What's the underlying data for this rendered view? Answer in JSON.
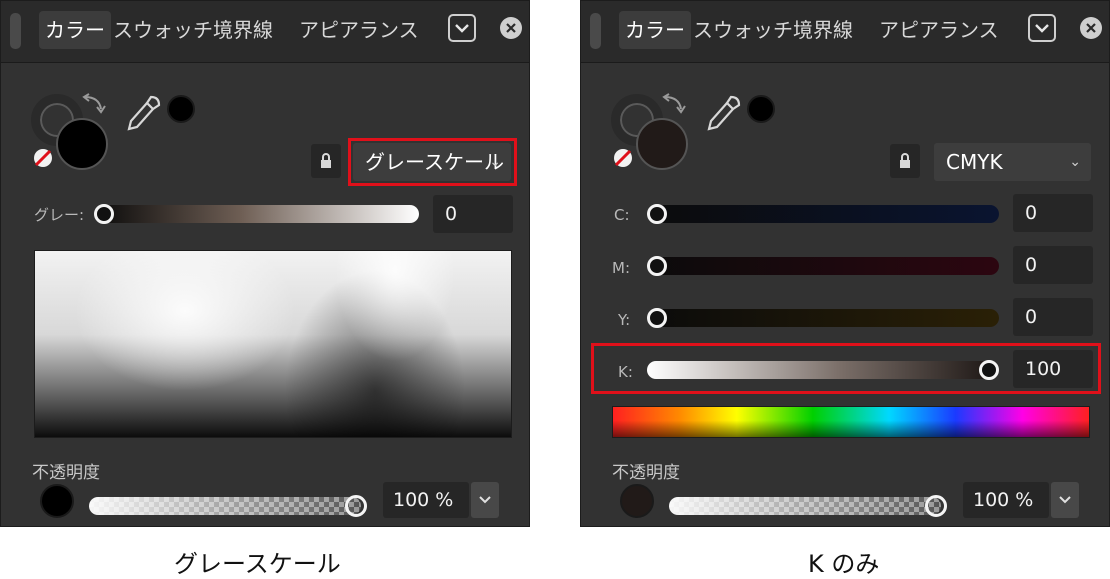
{
  "tabs": [
    "カラー",
    "スウォッチ",
    "境界線",
    "アピアランス"
  ],
  "left": {
    "mode": "グレースケール",
    "gray_label": "グレー:",
    "gray_value": "0",
    "opacity_label": "不透明度",
    "opacity_value": "100 %",
    "caption": "グレースケール"
  },
  "right": {
    "mode": "CMYK",
    "channels": [
      {
        "label": "C:",
        "value": "0",
        "level": 0
      },
      {
        "label": "M:",
        "value": "0",
        "level": 0
      },
      {
        "label": "Y:",
        "value": "0",
        "level": 0
      },
      {
        "label": "K:",
        "value": "100",
        "level": 100
      }
    ],
    "opacity_label": "不透明度",
    "opacity_value": "100 %",
    "caption": "K のみ"
  },
  "colors": {
    "highlight": "#e0101a",
    "panel_bg": "#323232"
  }
}
